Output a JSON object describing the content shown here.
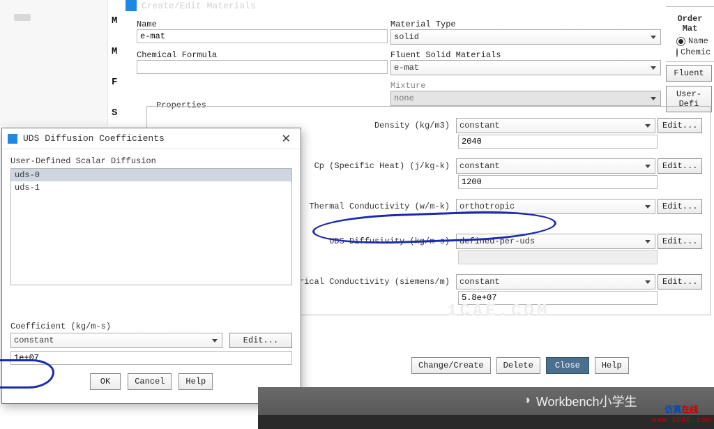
{
  "top_text": "Create/Edit Materials",
  "left_letters": [
    "M",
    "M",
    "F",
    "S"
  ],
  "form": {
    "name_label": "Name",
    "name_value": "e-mat",
    "chem_label": "Chemical Formula",
    "chem_value": "",
    "mat_type_label": "Material Type",
    "mat_type_value": "solid",
    "fsm_label": "Fluent Solid Materials",
    "fsm_value": "e-mat",
    "mixture_label": "Mixture",
    "mixture_value": "none"
  },
  "order": {
    "title": "Order Mat",
    "name": "Name",
    "chem": "Chemic",
    "fluent_btn": "Fluent",
    "userdef_btn": "User-Defi"
  },
  "props_title": "Properties",
  "props": {
    "density": {
      "label": "Density (kg/m3)",
      "method": "constant",
      "value": "2040"
    },
    "cp": {
      "label": "Cp (Specific Heat) (j/kg-k)",
      "method": "constant",
      "value": "1200"
    },
    "tcond": {
      "label": "Thermal Conductivity (w/m-k)",
      "method": "orthotropic",
      "value": ""
    },
    "udsdiff": {
      "label": "UDS Diffusivity (kg/m-s)",
      "method": "defined-per-uds",
      "value": ""
    },
    "econd": {
      "label": "rical Conductivity (siemens/m)",
      "method": "constant",
      "value": "5.8e+07"
    },
    "edit": "Edit..."
  },
  "watermark": "1CAE.COM",
  "bottom": {
    "change": "Change/Create",
    "delete": "Delete",
    "close": "Close",
    "help": "Help"
  },
  "dialog": {
    "title": "UDS Diffusion Coefficients",
    "subtitle": "User-Defined Scalar Diffusion",
    "items": [
      "uds-0",
      "uds-1"
    ],
    "coef_label": "Coefficient (kg/m-s)",
    "coef_method": "constant",
    "coef_value": "1e+07",
    "edit": "Edit...",
    "ok": "OK",
    "cancel": "Cancel",
    "help": "Help"
  },
  "footer": {
    "wb": "Workbench小学生",
    "site1a": "仿真",
    "site1b": "在线",
    "site2": "www.1CAE.com"
  }
}
